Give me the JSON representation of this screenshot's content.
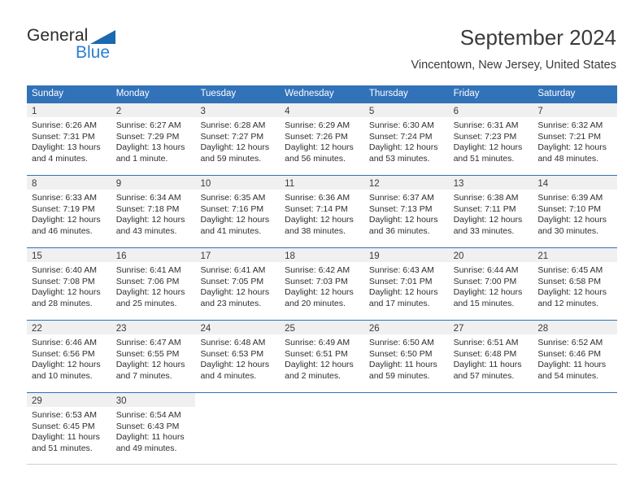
{
  "brand": {
    "name_part1": "General",
    "name_part2": "Blue",
    "triangle_color": "#1b69b0",
    "blue_color": "#2a7fd4"
  },
  "header": {
    "title": "September 2024",
    "subtitle": "Vincentown, New Jersey, United States"
  },
  "theme": {
    "header_bg": "#3172b9",
    "day_band_bg": "#f0f0f0",
    "text_color": "#2e2e2e"
  },
  "weekdays": [
    "Sunday",
    "Monday",
    "Tuesday",
    "Wednesday",
    "Thursday",
    "Friday",
    "Saturday"
  ],
  "weeks": [
    {
      "days": [
        {
          "number": "1",
          "sunrise": "Sunrise: 6:26 AM",
          "sunset": "Sunset: 7:31 PM",
          "daylight_line1": "Daylight: 13 hours",
          "daylight_line2": "and 4 minutes."
        },
        {
          "number": "2",
          "sunrise": "Sunrise: 6:27 AM",
          "sunset": "Sunset: 7:29 PM",
          "daylight_line1": "Daylight: 13 hours",
          "daylight_line2": "and 1 minute."
        },
        {
          "number": "3",
          "sunrise": "Sunrise: 6:28 AM",
          "sunset": "Sunset: 7:27 PM",
          "daylight_line1": "Daylight: 12 hours",
          "daylight_line2": "and 59 minutes."
        },
        {
          "number": "4",
          "sunrise": "Sunrise: 6:29 AM",
          "sunset": "Sunset: 7:26 PM",
          "daylight_line1": "Daylight: 12 hours",
          "daylight_line2": "and 56 minutes."
        },
        {
          "number": "5",
          "sunrise": "Sunrise: 6:30 AM",
          "sunset": "Sunset: 7:24 PM",
          "daylight_line1": "Daylight: 12 hours",
          "daylight_line2": "and 53 minutes."
        },
        {
          "number": "6",
          "sunrise": "Sunrise: 6:31 AM",
          "sunset": "Sunset: 7:23 PM",
          "daylight_line1": "Daylight: 12 hours",
          "daylight_line2": "and 51 minutes."
        },
        {
          "number": "7",
          "sunrise": "Sunrise: 6:32 AM",
          "sunset": "Sunset: 7:21 PM",
          "daylight_line1": "Daylight: 12 hours",
          "daylight_line2": "and 48 minutes."
        }
      ]
    },
    {
      "days": [
        {
          "number": "8",
          "sunrise": "Sunrise: 6:33 AM",
          "sunset": "Sunset: 7:19 PM",
          "daylight_line1": "Daylight: 12 hours",
          "daylight_line2": "and 46 minutes."
        },
        {
          "number": "9",
          "sunrise": "Sunrise: 6:34 AM",
          "sunset": "Sunset: 7:18 PM",
          "daylight_line1": "Daylight: 12 hours",
          "daylight_line2": "and 43 minutes."
        },
        {
          "number": "10",
          "sunrise": "Sunrise: 6:35 AM",
          "sunset": "Sunset: 7:16 PM",
          "daylight_line1": "Daylight: 12 hours",
          "daylight_line2": "and 41 minutes."
        },
        {
          "number": "11",
          "sunrise": "Sunrise: 6:36 AM",
          "sunset": "Sunset: 7:14 PM",
          "daylight_line1": "Daylight: 12 hours",
          "daylight_line2": "and 38 minutes."
        },
        {
          "number": "12",
          "sunrise": "Sunrise: 6:37 AM",
          "sunset": "Sunset: 7:13 PM",
          "daylight_line1": "Daylight: 12 hours",
          "daylight_line2": "and 36 minutes."
        },
        {
          "number": "13",
          "sunrise": "Sunrise: 6:38 AM",
          "sunset": "Sunset: 7:11 PM",
          "daylight_line1": "Daylight: 12 hours",
          "daylight_line2": "and 33 minutes."
        },
        {
          "number": "14",
          "sunrise": "Sunrise: 6:39 AM",
          "sunset": "Sunset: 7:10 PM",
          "daylight_line1": "Daylight: 12 hours",
          "daylight_line2": "and 30 minutes."
        }
      ]
    },
    {
      "days": [
        {
          "number": "15",
          "sunrise": "Sunrise: 6:40 AM",
          "sunset": "Sunset: 7:08 PM",
          "daylight_line1": "Daylight: 12 hours",
          "daylight_line2": "and 28 minutes."
        },
        {
          "number": "16",
          "sunrise": "Sunrise: 6:41 AM",
          "sunset": "Sunset: 7:06 PM",
          "daylight_line1": "Daylight: 12 hours",
          "daylight_line2": "and 25 minutes."
        },
        {
          "number": "17",
          "sunrise": "Sunrise: 6:41 AM",
          "sunset": "Sunset: 7:05 PM",
          "daylight_line1": "Daylight: 12 hours",
          "daylight_line2": "and 23 minutes."
        },
        {
          "number": "18",
          "sunrise": "Sunrise: 6:42 AM",
          "sunset": "Sunset: 7:03 PM",
          "daylight_line1": "Daylight: 12 hours",
          "daylight_line2": "and 20 minutes."
        },
        {
          "number": "19",
          "sunrise": "Sunrise: 6:43 AM",
          "sunset": "Sunset: 7:01 PM",
          "daylight_line1": "Daylight: 12 hours",
          "daylight_line2": "and 17 minutes."
        },
        {
          "number": "20",
          "sunrise": "Sunrise: 6:44 AM",
          "sunset": "Sunset: 7:00 PM",
          "daylight_line1": "Daylight: 12 hours",
          "daylight_line2": "and 15 minutes."
        },
        {
          "number": "21",
          "sunrise": "Sunrise: 6:45 AM",
          "sunset": "Sunset: 6:58 PM",
          "daylight_line1": "Daylight: 12 hours",
          "daylight_line2": "and 12 minutes."
        }
      ]
    },
    {
      "days": [
        {
          "number": "22",
          "sunrise": "Sunrise: 6:46 AM",
          "sunset": "Sunset: 6:56 PM",
          "daylight_line1": "Daylight: 12 hours",
          "daylight_line2": "and 10 minutes."
        },
        {
          "number": "23",
          "sunrise": "Sunrise: 6:47 AM",
          "sunset": "Sunset: 6:55 PM",
          "daylight_line1": "Daylight: 12 hours",
          "daylight_line2": "and 7 minutes."
        },
        {
          "number": "24",
          "sunrise": "Sunrise: 6:48 AM",
          "sunset": "Sunset: 6:53 PM",
          "daylight_line1": "Daylight: 12 hours",
          "daylight_line2": "and 4 minutes."
        },
        {
          "number": "25",
          "sunrise": "Sunrise: 6:49 AM",
          "sunset": "Sunset: 6:51 PM",
          "daylight_line1": "Daylight: 12 hours",
          "daylight_line2": "and 2 minutes."
        },
        {
          "number": "26",
          "sunrise": "Sunrise: 6:50 AM",
          "sunset": "Sunset: 6:50 PM",
          "daylight_line1": "Daylight: 11 hours",
          "daylight_line2": "and 59 minutes."
        },
        {
          "number": "27",
          "sunrise": "Sunrise: 6:51 AM",
          "sunset": "Sunset: 6:48 PM",
          "daylight_line1": "Daylight: 11 hours",
          "daylight_line2": "and 57 minutes."
        },
        {
          "number": "28",
          "sunrise": "Sunrise: 6:52 AM",
          "sunset": "Sunset: 6:46 PM",
          "daylight_line1": "Daylight: 11 hours",
          "daylight_line2": "and 54 minutes."
        }
      ]
    },
    {
      "days": [
        {
          "number": "29",
          "sunrise": "Sunrise: 6:53 AM",
          "sunset": "Sunset: 6:45 PM",
          "daylight_line1": "Daylight: 11 hours",
          "daylight_line2": "and 51 minutes."
        },
        {
          "number": "30",
          "sunrise": "Sunrise: 6:54 AM",
          "sunset": "Sunset: 6:43 PM",
          "daylight_line1": "Daylight: 11 hours",
          "daylight_line2": "and 49 minutes."
        },
        {
          "number": "",
          "sunrise": "",
          "sunset": "",
          "daylight_line1": "",
          "daylight_line2": ""
        },
        {
          "number": "",
          "sunrise": "",
          "sunset": "",
          "daylight_line1": "",
          "daylight_line2": ""
        },
        {
          "number": "",
          "sunrise": "",
          "sunset": "",
          "daylight_line1": "",
          "daylight_line2": ""
        },
        {
          "number": "",
          "sunrise": "",
          "sunset": "",
          "daylight_line1": "",
          "daylight_line2": ""
        },
        {
          "number": "",
          "sunrise": "",
          "sunset": "",
          "daylight_line1": "",
          "daylight_line2": ""
        }
      ]
    }
  ]
}
